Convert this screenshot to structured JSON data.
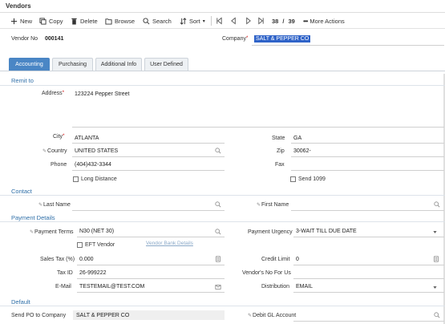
{
  "window": {
    "title": "Vendors"
  },
  "toolbar": {
    "new_label": "New",
    "copy_label": "Copy",
    "delete_label": "Delete",
    "browse_label": "Browse",
    "search_label": "Search",
    "sort_label": "Sort",
    "record_current": "38",
    "record_separator": "/",
    "record_total": "39",
    "more_label": "More Actions"
  },
  "header": {
    "vendor_no_label": "Vendor No",
    "vendor_no_value": "000141",
    "company_label": "Company",
    "company_value": "SALT & PEPPER CO"
  },
  "tabs": [
    {
      "label": "Accounting",
      "active": true
    },
    {
      "label": "Purchasing",
      "active": false
    },
    {
      "label": "Additional Info",
      "active": false
    },
    {
      "label": "User Defined",
      "active": false
    }
  ],
  "remit": {
    "section_label": "Remit to",
    "address_label": "Address",
    "address_value": "123224 Pepper Street",
    "city_label": "City",
    "city_value": "ATLANTA",
    "state_label": "State",
    "state_value": "GA",
    "country_label": "Country",
    "country_value": "UNITED STATES",
    "zip_label": "Zip",
    "zip_value": "30062-",
    "phone_label": "Phone",
    "phone_value": "(404)432-3344",
    "fax_label": "Fax",
    "fax_value": "",
    "long_distance_label": "Long Distance",
    "long_distance_checked": false,
    "send1099_label": "Send 1099",
    "send1099_checked": false
  },
  "contact": {
    "section_label": "Contact",
    "last_name_label": "Last Name",
    "last_name_value": "",
    "first_name_label": "First Name",
    "first_name_value": ""
  },
  "payment": {
    "section_label": "Payment Details",
    "terms_label": "Payment Terms",
    "terms_value": "N30 (NET 30)",
    "urgency_label": "Payment Urgency",
    "urgency_value": "3-WAIT TILL DUE DATE",
    "eft_label": "EFT Vendor",
    "eft_checked": false,
    "bank_details_link": "Vendor Bank Details",
    "sales_tax_label": "Sales Tax (%)",
    "sales_tax_value": "0.000",
    "credit_limit_label": "Credit Limit",
    "credit_limit_value": "0",
    "tax_id_label": "Tax ID",
    "tax_id_value": "26-999222",
    "vendors_no_label": "Vendor's No For Us",
    "vendors_no_value": "",
    "email_label": "E-Mail",
    "email_value": "TESTEMAIL@TEST.COM",
    "distribution_label": "Distribution",
    "distribution_value": "EMAIL"
  },
  "default": {
    "section_label": "Default",
    "send_po_label": "Send PO to Company",
    "send_po_value": "SALT & PEPPER CO",
    "debit_gl_label": "Debit GL Account",
    "debit_gl_value": ""
  },
  "colors": {
    "accent": "#4a86c5",
    "selection": "#2f63c8",
    "section": "#2f6fa8",
    "required": "#cc0000"
  }
}
